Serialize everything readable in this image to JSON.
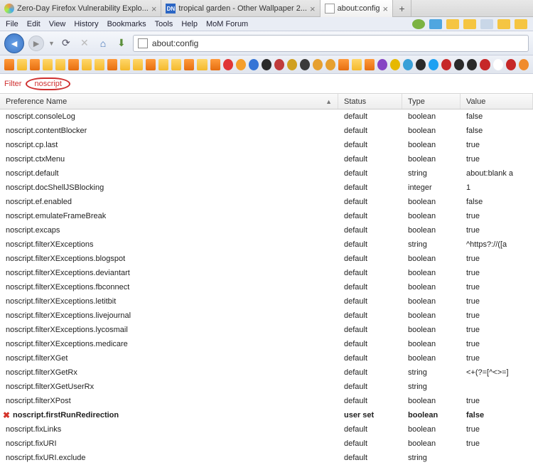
{
  "tabs": [
    {
      "label": "Zero-Day Firefox Vulnerability Explo..."
    },
    {
      "label": "tropical garden - Other Wallpaper 2..."
    },
    {
      "label": "about:config"
    }
  ],
  "menu": {
    "file": "File",
    "edit": "Edit",
    "view": "View",
    "history": "History",
    "bookmarks": "Bookmarks",
    "tools": "Tools",
    "help": "Help",
    "mom": "MoM Forum"
  },
  "url": "about:config",
  "filter": {
    "label": "Filter",
    "value": "noscript"
  },
  "columns": {
    "name": "Preference Name",
    "status": "Status",
    "type": "Type",
    "value": "Value"
  },
  "rows": [
    {
      "name": "noscript.consoleLog",
      "status": "default",
      "type": "boolean",
      "value": "false"
    },
    {
      "name": "noscript.contentBlocker",
      "status": "default",
      "type": "boolean",
      "value": "false"
    },
    {
      "name": "noscript.cp.last",
      "status": "default",
      "type": "boolean",
      "value": "true"
    },
    {
      "name": "noscript.ctxMenu",
      "status": "default",
      "type": "boolean",
      "value": "true"
    },
    {
      "name": "noscript.default",
      "status": "default",
      "type": "string",
      "value": "about:blank a"
    },
    {
      "name": "noscript.docShellJSBlocking",
      "status": "default",
      "type": "integer",
      "value": "1"
    },
    {
      "name": "noscript.ef.enabled",
      "status": "default",
      "type": "boolean",
      "value": "false"
    },
    {
      "name": "noscript.emulateFrameBreak",
      "status": "default",
      "type": "boolean",
      "value": "true"
    },
    {
      "name": "noscript.excaps",
      "status": "default",
      "type": "boolean",
      "value": "true"
    },
    {
      "name": "noscript.filterXExceptions",
      "status": "default",
      "type": "string",
      "value": "^https?://([a"
    },
    {
      "name": "noscript.filterXExceptions.blogspot",
      "status": "default",
      "type": "boolean",
      "value": "true"
    },
    {
      "name": "noscript.filterXExceptions.deviantart",
      "status": "default",
      "type": "boolean",
      "value": "true"
    },
    {
      "name": "noscript.filterXExceptions.fbconnect",
      "status": "default",
      "type": "boolean",
      "value": "true"
    },
    {
      "name": "noscript.filterXExceptions.letitbit",
      "status": "default",
      "type": "boolean",
      "value": "true"
    },
    {
      "name": "noscript.filterXExceptions.livejournal",
      "status": "default",
      "type": "boolean",
      "value": "true"
    },
    {
      "name": "noscript.filterXExceptions.lycosmail",
      "status": "default",
      "type": "boolean",
      "value": "true"
    },
    {
      "name": "noscript.filterXExceptions.medicare",
      "status": "default",
      "type": "boolean",
      "value": "true"
    },
    {
      "name": "noscript.filterXGet",
      "status": "default",
      "type": "boolean",
      "value": "true"
    },
    {
      "name": "noscript.filterXGetRx",
      "status": "default",
      "type": "string",
      "value": "<+(?=[^<>=]"
    },
    {
      "name": "noscript.filterXGetUserRx",
      "status": "default",
      "type": "string",
      "value": ""
    },
    {
      "name": "noscript.filterXPost",
      "status": "default",
      "type": "boolean",
      "value": "true"
    },
    {
      "name": "noscript.firstRunRedirection",
      "status": "user set",
      "type": "boolean",
      "value": "false",
      "userset": true,
      "mark": true
    },
    {
      "name": "noscript.fixLinks",
      "status": "default",
      "type": "boolean",
      "value": "true"
    },
    {
      "name": "noscript.fixURI",
      "status": "default",
      "type": "boolean",
      "value": "true"
    },
    {
      "name": "noscript.fixURI.exclude",
      "status": "default",
      "type": "string",
      "value": ""
    }
  ],
  "colors": {
    "weather": [
      "#7cb342",
      "#4fa6e0",
      "#f5c542",
      "#f5c542",
      "#c9d7e8",
      "#f5c542",
      "#f5c542"
    ],
    "bmk": [
      "rss",
      "folder",
      "rss",
      "folder",
      "folder",
      "rss",
      "folder",
      "folder",
      "rss",
      "folder",
      "folder",
      "rss",
      "folder",
      "folder",
      "rss",
      "folder",
      "rss"
    ],
    "extra": [
      "#e03535",
      "#f59f2c",
      "#3575d6",
      "#2a2a2a",
      "#c03c3c",
      "#d0a020",
      "#3a3a3a",
      "#e6a030",
      "#e6a030",
      "rss",
      "folder",
      "rss",
      "#8645c4",
      "#e6b800",
      "#39a0d8",
      "#2a2a2a",
      "#1da1f2",
      "#c62828",
      "#2a2a2a",
      "#2a2a2a",
      "#c62828",
      "#fff",
      "#c62828",
      "#f08c2e"
    ]
  }
}
